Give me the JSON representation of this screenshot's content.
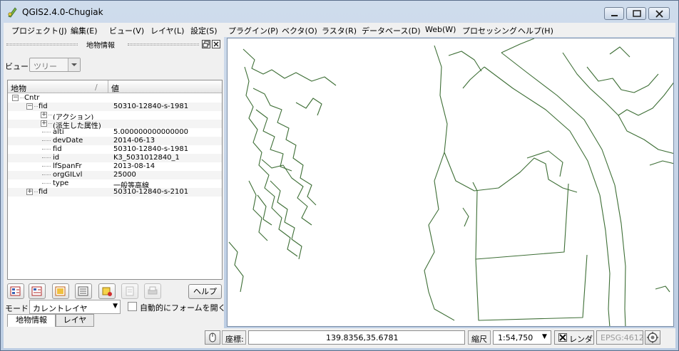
{
  "window": {
    "title": "QGIS2.4.0-Chugiak"
  },
  "menubar": {
    "items": [
      "プロジェクト(J)",
      "編集(E)",
      "ビュー(V)",
      "レイヤ(L)",
      "設定(S)",
      "プラグイン(P)",
      "ベクタ(O)",
      "ラスタ(R)",
      "データベース(D)",
      "Web(W)",
      "プロセッシング",
      "ヘルプ(H)"
    ]
  },
  "identify_panel": {
    "title": "地物情報",
    "view_label": "ビュー",
    "view_value": "ツリー",
    "columns": {
      "feature": "地物",
      "value": "値"
    },
    "rows": [
      {
        "key": "Cntr",
        "value": "",
        "level": 0,
        "expander": "−"
      },
      {
        "key": "fid",
        "value": "50310-12840-s-1981",
        "level": 1,
        "expander": "−"
      },
      {
        "key": "(アクション)",
        "value": "",
        "level": 2,
        "expander": "+"
      },
      {
        "key": "(派生した属性)",
        "value": "",
        "level": 2,
        "expander": "+"
      },
      {
        "key": "alti",
        "value": "5.000000000000000",
        "level": 2,
        "expander": ""
      },
      {
        "key": "devDate",
        "value": "2014-06-13",
        "level": 2,
        "expander": ""
      },
      {
        "key": "fid",
        "value": "50310-12840-s-1981",
        "level": 2,
        "expander": ""
      },
      {
        "key": "id",
        "value": "K3_5031012840_1",
        "level": 2,
        "expander": ""
      },
      {
        "key": "lfSpanFr",
        "value": "2013-08-14",
        "level": 2,
        "expander": ""
      },
      {
        "key": "orgGILvl",
        "value": "25000",
        "level": 2,
        "expander": ""
      },
      {
        "key": "type",
        "value": "一般等高線",
        "level": 2,
        "expander": ""
      },
      {
        "key": "fid",
        "value": "50310-12840-s-2101",
        "level": 1,
        "expander": "+"
      }
    ],
    "help_label": "ヘルプ",
    "mode_label": "モード",
    "mode_value": "カレントレイヤ",
    "auto_open_label": "自動的にフォームを開く",
    "auto_open_checked": false,
    "tabs": [
      "地物情報",
      "レイヤ"
    ]
  },
  "statusbar": {
    "coord_label": "座標:",
    "coord_value": "139.8356,35.6781",
    "scale_label": "縮尺",
    "scale_value": "1:54,750",
    "render_label": "レンダ",
    "render_checked": true,
    "crs_label": "EPSG:4612"
  },
  "colors": {
    "map_line": "#3d6e35",
    "title_bg": "#cfdcec"
  }
}
